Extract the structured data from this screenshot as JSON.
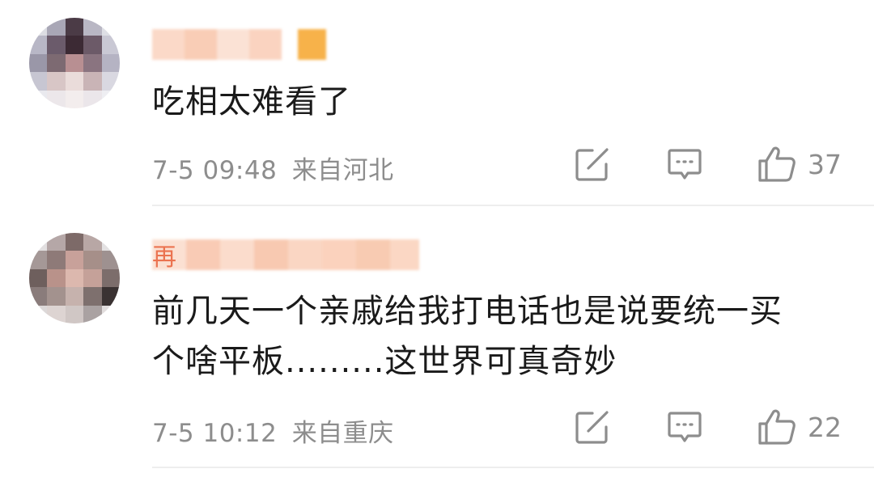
{
  "comments": [
    {
      "username_visible": "",
      "content": "吃相太难看了",
      "time": "7-5 09:48",
      "location": "来自河北",
      "likes": "37",
      "icons": {
        "repost": "repost-icon",
        "reply": "comment-icon",
        "like": "thumbs-up-icon"
      }
    },
    {
      "username_visible": "再",
      "content_line1": "前几天一个亲戚给我打电话也是说要统一买",
      "content_line2": "个啥平板.........这世界可真奇妙",
      "time": "7-5 10:12",
      "location": "来自重庆",
      "likes": "22",
      "icons": {
        "repost": "repost-icon",
        "reply": "comment-icon",
        "like": "thumbs-up-icon"
      }
    }
  ],
  "colors": {
    "username": "#eb7350",
    "meta": "#8d8d8d",
    "text": "#1a1a1a",
    "divider": "#eeeeee"
  }
}
